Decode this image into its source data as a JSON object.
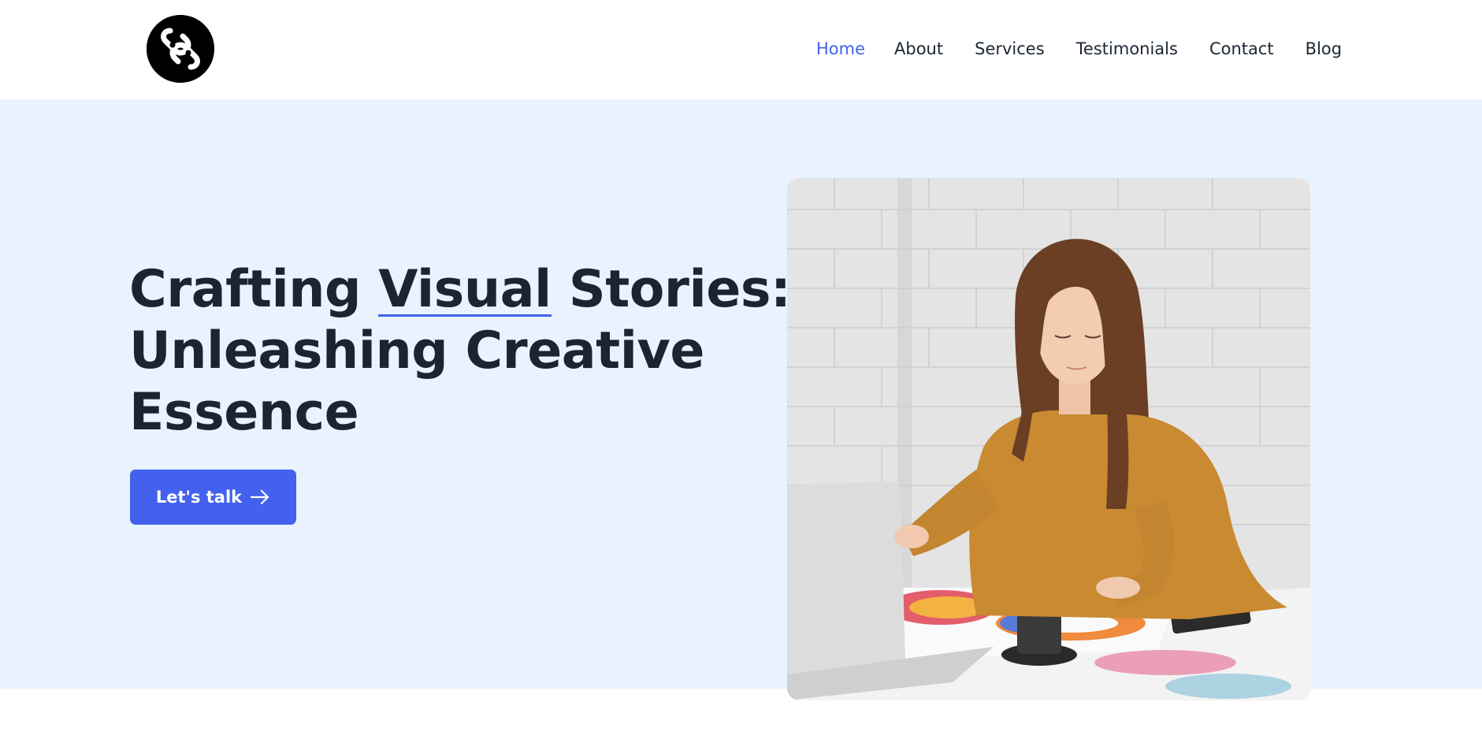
{
  "header": {
    "logo": {
      "icon": "infinity-loop-logo-icon"
    },
    "nav": [
      {
        "label": "Home",
        "active": true
      },
      {
        "label": "About",
        "active": false
      },
      {
        "label": "Services",
        "active": false
      },
      {
        "label": "Testimonials",
        "active": false
      },
      {
        "label": "Contact",
        "active": false
      },
      {
        "label": "Blog",
        "active": false
      }
    ]
  },
  "hero": {
    "headline": {
      "line1_before": "Crafting ",
      "line1_accent": "Visual",
      "line1_after": " Stories:",
      "line2": "Unleashing Creative",
      "line3": "Essence"
    },
    "cta": {
      "label": "Let's talk",
      "icon": "arrow-right-icon"
    },
    "photo": {
      "description": ""
    }
  },
  "colors": {
    "accent": "#4361ee",
    "hero_bg": "#e9f3fd",
    "text": "#1c2633"
  }
}
